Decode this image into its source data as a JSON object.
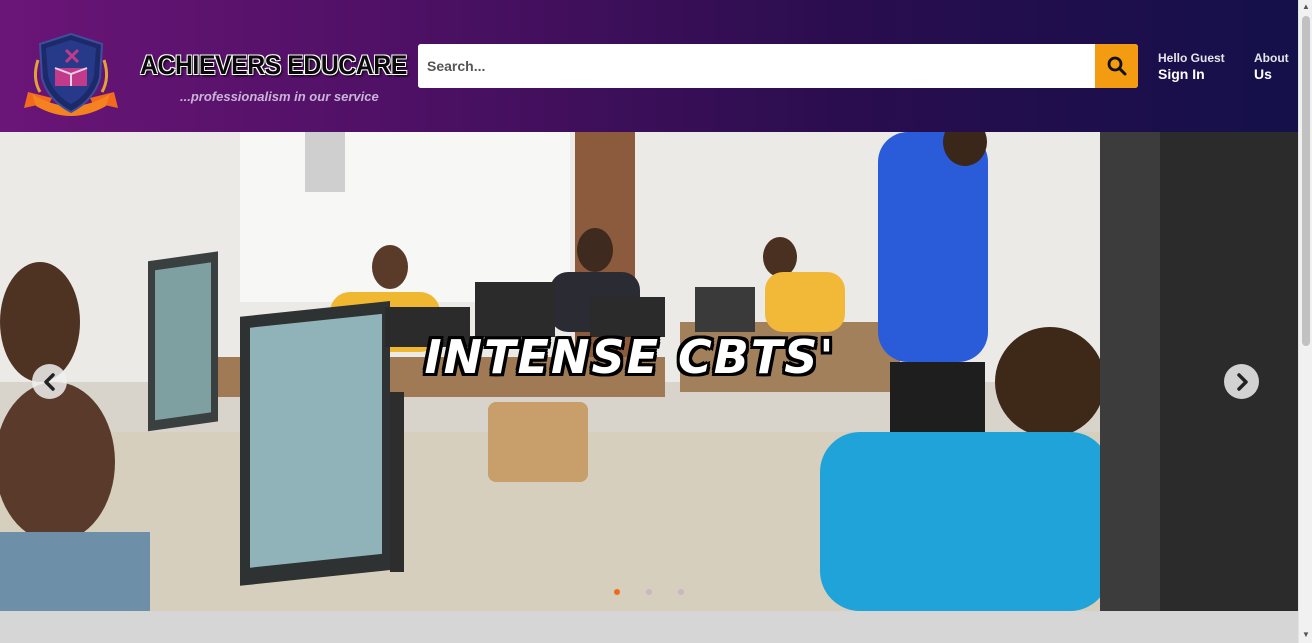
{
  "brand": {
    "title": "ACHIEVERS EDUCARE",
    "tagline": "...professionalism in our service",
    "logo_icon": "shield-crest-logo"
  },
  "search": {
    "placeholder": "Search...",
    "value": "",
    "button_icon": "search-icon"
  },
  "nav": {
    "greeting": "Hello Guest",
    "sign_in": "Sign In",
    "about_line1": "About",
    "about_line2": "Us"
  },
  "carousel": {
    "caption": "INTENSE CBTS'",
    "prev_icon": "chevron-left-icon",
    "next_icon": "chevron-right-icon",
    "slide_count": 3,
    "active_slide": 1
  },
  "colors": {
    "header_start": "#6b1578",
    "header_end": "#14104a",
    "accent": "#f39c12",
    "active_dot": "#f06a1a"
  }
}
